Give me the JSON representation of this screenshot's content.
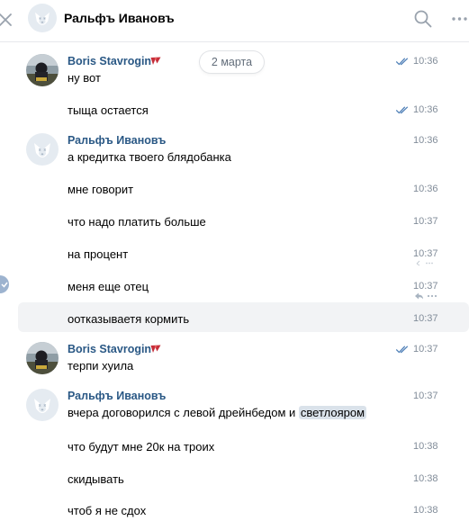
{
  "header": {
    "title": "Ральфъ Ивановъ"
  },
  "date_badge": "2 марта",
  "senders": {
    "boris": "Boris Stavrogin",
    "ralf": "Ральфъ Ивановъ"
  },
  "icons": {
    "close": "close-icon",
    "search": "search-icon",
    "more": "more-dots-icon",
    "read": "double-check-icon",
    "verified": "red-badge-icon",
    "reply": "reply-icon",
    "edge": "checkmark-icon"
  },
  "colors": {
    "name": "#2a5885",
    "time": "#818c99",
    "check": "#5181b8",
    "highlight": "#f2f3f5",
    "selection": "#dae2ea"
  },
  "messages": [
    {
      "author": "Boris Stavrogin",
      "text": "ну вот",
      "time": "10:36"
    },
    {
      "text": "тыща остается",
      "time": "10:36"
    },
    {
      "author": "Ральфъ Ивановъ",
      "text": "а кредитка твоего блядобанка",
      "time": "10:36"
    },
    {
      "text": "мне говорит",
      "time": "10:36"
    },
    {
      "text": "что надо платить больше",
      "time": "10:37"
    },
    {
      "text": "на процент",
      "time": "10:37"
    },
    {
      "text": "меня еще отец",
      "time": "10:37"
    },
    {
      "text": "оотказываетя кормить",
      "time": "10:37"
    },
    {
      "author": "Boris Stavrogin",
      "text": "терпи хуила",
      "time": "10:37"
    },
    {
      "author": "Ральфъ Ивановъ",
      "text_before": "вчера договорился с левой дрейнбедом и ",
      "text_selected": "светлояром",
      "time": "10:37"
    },
    {
      "text": "что будут мне 20к на троих",
      "time": "10:38"
    },
    {
      "text": "скидывать",
      "time": "10:38"
    },
    {
      "text": "чтоб я не сдох",
      "time": "10:38"
    }
  ]
}
